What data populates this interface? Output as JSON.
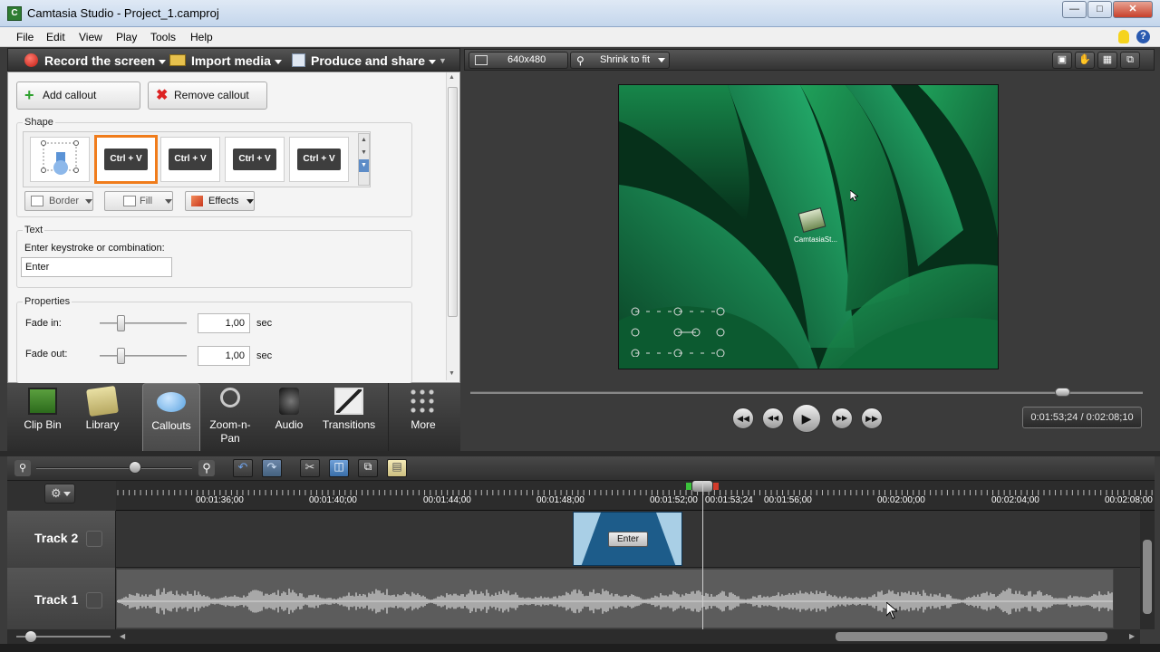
{
  "window": {
    "title": "Camtasia Studio - Project_1.camproj"
  },
  "menu": [
    "File",
    "Edit",
    "View",
    "Play",
    "Tools",
    "Help"
  ],
  "toolbar": {
    "record_label": "Record the screen",
    "import_label": "Import media",
    "produce_label": "Produce and share"
  },
  "callouts_panel": {
    "add_label": "Add callout",
    "remove_label": "Remove callout",
    "shape_label": "Shape",
    "shape_thumbs": [
      "Ctrl",
      "+",
      "V"
    ],
    "border_label": "Border",
    "fill_label": "Fill",
    "effects_label": "Effects",
    "text_label": "Text",
    "keystroke_prompt": "Enter keystroke or combination:",
    "keystroke_value": "Enter",
    "properties_label": "Properties",
    "fade_in_label": "Fade in:",
    "fade_in_value": "1,00",
    "fade_in_level": 0.2,
    "fade_out_label": "Fade out:",
    "fade_out_value": "1,00",
    "fade_out_level": 0.2,
    "unit": "sec"
  },
  "tasks": [
    "Clip Bin",
    "Library",
    "Callouts",
    "Zoom-n-Pan",
    "Audio",
    "Transitions",
    "More"
  ],
  "preview": {
    "dimensions": "640x480",
    "zoom": "Shrink to fit",
    "desktop_icon_label": "CamtasiaSt...",
    "progress": 0.88
  },
  "player": {
    "timecode": "0:01:53;24 / 0:02:08;10"
  },
  "timeline": {
    "ruler_labels": [
      "00:01:36;00",
      "00:01:40;00",
      "00:01:44;00",
      "00:01:48;00",
      "00:01:52;00",
      "00:01:53;24",
      "00:01:56;00",
      "00:02:00;00",
      "00:02:04;00",
      "00:02:08;00"
    ],
    "tracks": [
      "Track 2",
      "Track 1"
    ],
    "callout_clip_label": "Enter"
  },
  "colors": {
    "accent_selected": "#f07c1b",
    "callout_clip": "#1d5c8a"
  }
}
